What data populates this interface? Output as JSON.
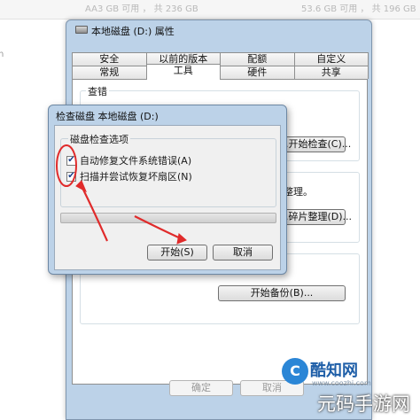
{
  "background": {
    "strip_left": "AA3 GB 可用 ， 共 236 GB",
    "strip_right": "53.6 GB 可用 ， 共 196 GB",
    "edge_char": "n"
  },
  "properties_window": {
    "title": "本地磁盘 (D:) 属性",
    "tabs_back": [
      "安全",
      "以前的版本",
      "配额",
      "自定义"
    ],
    "tabs_front": [
      "常规",
      "工具",
      "硬件",
      "共享"
    ],
    "active_tab": "工具",
    "error_check_group": "查错",
    "check_button": "...开始检查(C)...",
    "defrag_text": "整理。",
    "defrag_button": "...碎片整理(D)...",
    "backup_button": "开始备份(B)...",
    "ok_button": "确定",
    "cancel_button": "取消"
  },
  "check_disk_dialog": {
    "title": "检查磁盘 本地磁盘 (D:)",
    "group_label": "磁盘检查选项",
    "options": [
      {
        "label": "自动修复文件系统错误(A)",
        "checked": true
      },
      {
        "label": "扫描并尝试恢复坏扇区(N)",
        "checked": true
      }
    ],
    "progress": 0,
    "start_button": "开始(S)",
    "cancel_button": "取消"
  },
  "annotations": {
    "color": "#e02b2b"
  },
  "watermark": {
    "logo_glyph": "C",
    "brand": "酷知网",
    "url": "www.coozhi.com",
    "bottom": "元码手游网"
  }
}
